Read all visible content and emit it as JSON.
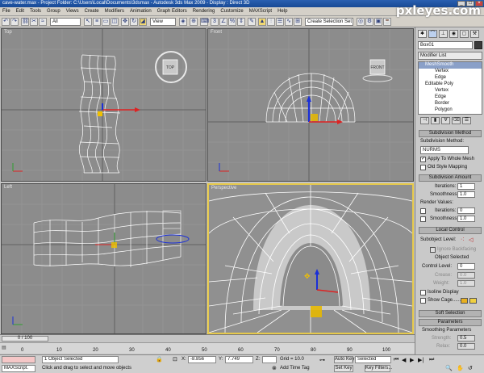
{
  "window": {
    "title": "cave-water.max - Project Folder: C:\\Users\\Local\\Documents\\3dsmax - Autodesk 3ds Max 2009 - Display : Direct 3D",
    "min": "_",
    "max": "□",
    "close": "×"
  },
  "menu": [
    "File",
    "Edit",
    "Tools",
    "Group",
    "Views",
    "Create",
    "Modifiers",
    "Animation",
    "Graph Editors",
    "Rendering",
    "Customize",
    "MAXScript",
    "Help"
  ],
  "toolbar": {
    "filter": "All",
    "refcoord": "View",
    "selset": "Create Selection Set"
  },
  "viewports": {
    "top": "Top",
    "front": "Front",
    "left": "Left",
    "persp": "Perspective",
    "cube_top": "TOP",
    "cube_front": "FRONT"
  },
  "panel": {
    "object_name": "Box01",
    "modifier_list": "Modifier List",
    "stack": [
      "MeshSmooth",
      "Vertex",
      "Edge",
      "Editable Poly",
      "Vertex",
      "Edge",
      "Border",
      "Polygon"
    ],
    "subdivision_method_title": "Subdivision Method",
    "subdivision_method_label": "Subdivision Method:",
    "subdivision_method_value": "NURMS",
    "apply_whole_mesh": "Apply To Whole Mesh",
    "old_style_mapping": "Old Style Mapping",
    "subdivision_amount_title": "Subdivision Amount",
    "iterations_label": "Iterations:",
    "iterations_value": "1",
    "smoothness_label": "Smoothness:",
    "smoothness_value": "1.0",
    "render_values": "Render Values:",
    "r_iterations_label": "Iterations:",
    "r_iterations_value": "0",
    "r_smoothness_label": "Smoothness:",
    "r_smoothness_value": "1.0",
    "local_control_title": "Local Control",
    "subobject_level": "Subobject Level:",
    "ignore_backfacing": "Ignore Backfacing",
    "object_selected": "Object Selected",
    "control_level": "Control Level:",
    "control_level_value": "0",
    "crease_label": "Crease:",
    "crease_value": "0.0",
    "weight_label": "Weight:",
    "weight_value": "1.0",
    "isoline_display": "Isoline Display",
    "show_cage": "Show Cage......",
    "soft_selection_title": "Soft Selection",
    "parameters_title": "Parameters",
    "smoothing_params": "Smoothing Parameters",
    "strength_label": "Strength:",
    "strength_value": "0.5",
    "relax_label": "Relax:",
    "relax_value": "0.0"
  },
  "timebar": {
    "frame": "0 / 100",
    "ticks": [
      "0",
      "10",
      "20",
      "30",
      "40",
      "50",
      "60",
      "70",
      "80",
      "90",
      "100"
    ]
  },
  "status": {
    "maxscript": "MAXScript.",
    "selected": "1 Object Selected",
    "prompt": "Click and drag to select and move objects",
    "x_label": "X:",
    "x_value": "-8.856",
    "y_label": "Y:",
    "y_value": "7.749",
    "z_label": "Z:",
    "z_value": "",
    "grid": "Grid = 10.0",
    "add_time_tag": "Add Time Tag",
    "auto_key": "Auto Key",
    "set_key": "Set Key",
    "selected_drop": "Selected",
    "key_filters": "Key Filters..."
  },
  "watermark": "pxleyes.com"
}
